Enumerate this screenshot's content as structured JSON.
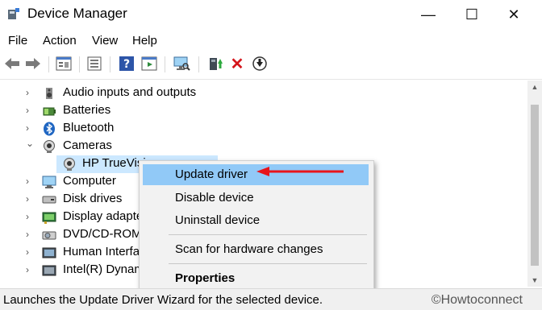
{
  "window": {
    "title": "Device Manager",
    "minimize": "—",
    "maximize": "☐",
    "close": "✕"
  },
  "menu": [
    "File",
    "Action",
    "View",
    "Help"
  ],
  "toolbar": {
    "buttons": [
      "back-icon",
      "forward-icon",
      "properties-icon",
      "show-hide-console-tree-icon",
      "help-icon",
      "action-pane-icon",
      "scan-hardware-icon",
      "update-driver-icon",
      "uninstall-icon",
      "disable-icon"
    ],
    "uninstall_glyph": "✕",
    "disable_glyph": "⬇"
  },
  "tree": {
    "expand_glyph": "›",
    "collapse_glyph": "⌄",
    "rows": [
      {
        "label": "Audio inputs and outputs",
        "icon": "speaker-icon",
        "expanded": false
      },
      {
        "label": "Batteries",
        "icon": "battery-icon",
        "expanded": false
      },
      {
        "label": "Bluetooth",
        "icon": "bluetooth-icon",
        "expanded": false
      },
      {
        "label": "Cameras",
        "icon": "camera-icon",
        "expanded": true
      },
      {
        "label": "HP TrueVisi",
        "icon": "webcam-icon",
        "child": true,
        "selected": true
      },
      {
        "label": "Computer",
        "icon": "computer-icon",
        "expanded": false
      },
      {
        "label": "Disk drives",
        "icon": "disk-drive-icon",
        "expanded": false
      },
      {
        "label": "Display adapte",
        "icon": "display-adapter-icon",
        "expanded": false
      },
      {
        "label": "DVD/CD-ROM",
        "icon": "dvd-icon",
        "expanded": false
      },
      {
        "label": "Human Interfa",
        "icon": "hid-icon",
        "expanded": false
      },
      {
        "label": "Intel(R) Dynam",
        "icon": "chip-icon",
        "expanded": false
      }
    ]
  },
  "context_menu": {
    "items": [
      {
        "label": "Update driver",
        "highlighted": true
      },
      {
        "label": "Disable device"
      },
      {
        "label": "Uninstall device"
      },
      {
        "separator": true
      },
      {
        "label": "Scan for hardware changes"
      },
      {
        "separator": true
      },
      {
        "label": "Properties",
        "bold": true
      }
    ]
  },
  "annotation": {
    "color": "#e8141b"
  },
  "status": {
    "text": "Launches the Update Driver Wizard for the selected device.",
    "watermark": "©Howtoconnect"
  }
}
